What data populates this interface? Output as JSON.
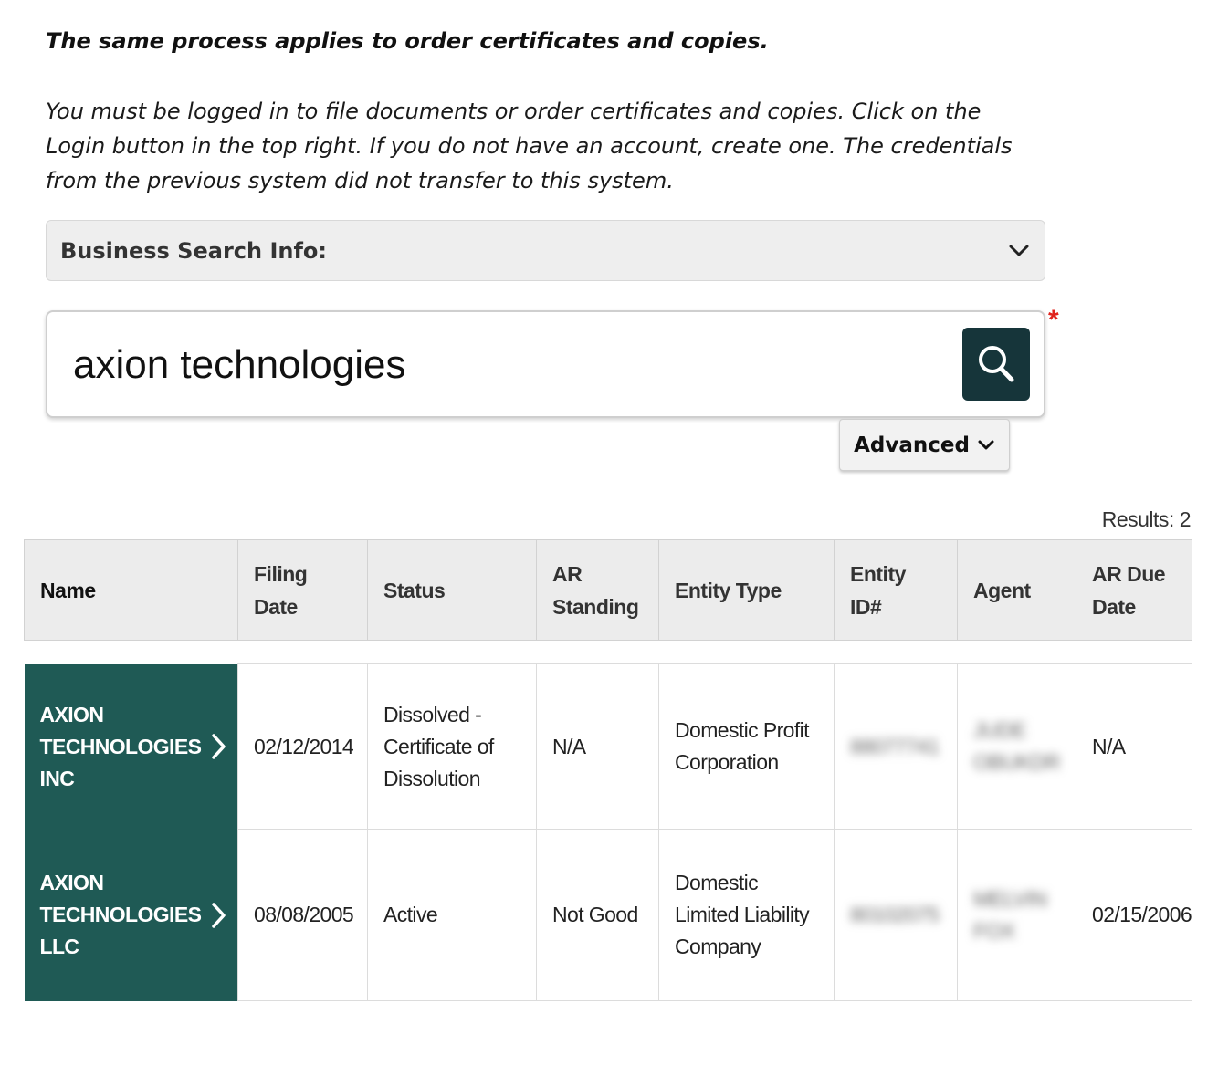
{
  "notice": {
    "title": "The same process applies to order certificates and copies.",
    "body": "You must be logged in to file documents or order certificates and copies. Click on the Login button in the top right. If you do not have an account, create one. The credentials from the previous system did not transfer to this system."
  },
  "accordion": {
    "label": "Business Search Info:",
    "icon": "chevron-down-icon"
  },
  "search": {
    "value": "axion technologies",
    "required_mark": "*",
    "button_icon": "search-icon",
    "button_color": "#16353a"
  },
  "advanced": {
    "label": "Advanced",
    "icon": "chevron-down-icon"
  },
  "results": {
    "count_label": "Results: 2",
    "columns": [
      "Name",
      "Filing Date",
      "Status",
      "AR Standing",
      "Entity Type",
      "Entity ID#",
      "Agent",
      "AR Due Date"
    ],
    "rows": [
      {
        "name": "AXION TECHNOLOGIES INC",
        "filing_date": "02/12/2014",
        "status": "Dissolved - Certificate of Dissolution",
        "ar_standing": "N/A",
        "entity_type": "Domestic Profit Corporation",
        "entity_id": "88077741",
        "agent": "JUDE OBUKDR",
        "ar_due_date": "N/A"
      },
      {
        "name": "AXION TECHNOLOGIES LLC",
        "filing_date": "08/08/2005",
        "status": "Active",
        "ar_standing": "Not Good",
        "entity_type": "Domestic Limited Liability Company",
        "entity_id": "80102075",
        "agent": "MELVIN FOX",
        "ar_due_date": "02/15/2006"
      }
    ]
  },
  "colors": {
    "name_cell_row1": "#1f5a55",
    "name_cell_row2": "#236660",
    "required": "#e0241d"
  }
}
